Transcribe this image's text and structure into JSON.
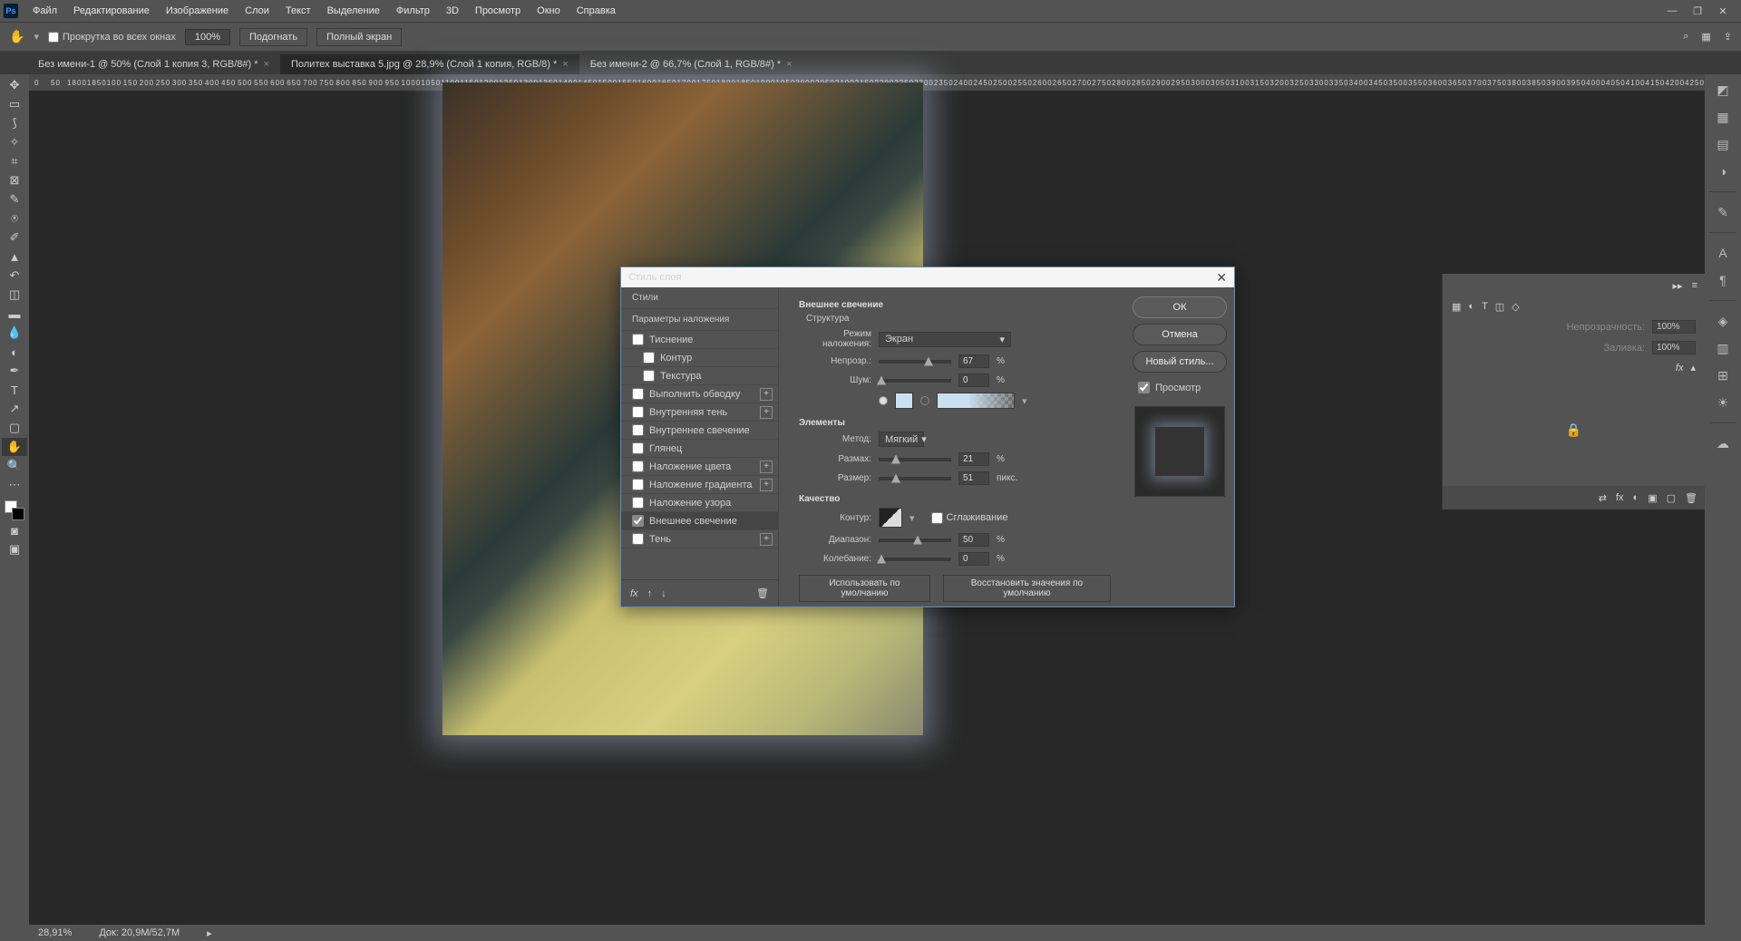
{
  "menubar": {
    "items": [
      "Файл",
      "Редактирование",
      "Изображение",
      "Слои",
      "Текст",
      "Выделение",
      "Фильтр",
      "3D",
      "Просмотр",
      "Окно",
      "Справка"
    ]
  },
  "optbar": {
    "scroll_all": "Прокрутка во всех окнах",
    "zoom": "100%",
    "fit": "Подогнать",
    "fullscreen": "Полный экран"
  },
  "tabs": [
    {
      "label": "Без имени-1 @ 50% (Слой 1 копия 3, RGB/8#) *",
      "active": false
    },
    {
      "label": "Политех выставка 5.jpg @ 28,9% (Слой 1 копия, RGB/8) *",
      "active": true
    },
    {
      "label": "Без имени-2 @ 66,7% (Слой 1, RGB/8#) *",
      "active": false
    }
  ],
  "ruler_h": [
    "0",
    "50",
    "1800",
    "1850",
    "100",
    "150",
    "200",
    "250",
    "300",
    "350",
    "400",
    "450",
    "500",
    "550",
    "600",
    "650",
    "700",
    "750",
    "800",
    "850",
    "900",
    "950",
    "1000",
    "1050",
    "1100",
    "1150",
    "1200",
    "1250",
    "1300",
    "1350",
    "1400",
    "1450",
    "1500",
    "1550",
    "1600",
    "1650",
    "1700",
    "1750",
    "1800",
    "1850",
    "1900",
    "1950",
    "2000",
    "2050",
    "2100",
    "2150",
    "2200",
    "2250",
    "2300",
    "2350",
    "2400",
    "2450",
    "2500",
    "2550",
    "2600",
    "2650",
    "2700",
    "2750",
    "2800",
    "2850",
    "2900",
    "2950",
    "3000",
    "3050",
    "3100",
    "3150",
    "3200",
    "3250",
    "3300",
    "3350",
    "3400",
    "3450",
    "3500",
    "3550",
    "3600",
    "3650",
    "3700",
    "3750",
    "3800",
    "3850",
    "3900",
    "3950",
    "4000",
    "4050",
    "4100",
    "4150",
    "4200",
    "4250"
  ],
  "props": {
    "opacity_label": "Непрозрачность:",
    "opacity": "100%",
    "fill_label": "Заливка:",
    "fill": "100%",
    "fx": "fx"
  },
  "status": {
    "zoom": "28,91%",
    "doc": "Док: 20,9М/52,7М"
  },
  "dialog": {
    "title": "Стиль слоя",
    "col1": {
      "styles_head": "Стили",
      "blend_head": "Параметры наложения",
      "rows": [
        {
          "label": "Тиснение",
          "sub": false,
          "plus": false,
          "checked": false
        },
        {
          "label": "Контур",
          "sub": true,
          "plus": false,
          "checked": false
        },
        {
          "label": "Текстура",
          "sub": true,
          "plus": false,
          "checked": false
        },
        {
          "label": "Выполнить обводку",
          "sub": false,
          "plus": true,
          "checked": false
        },
        {
          "label": "Внутренняя тень",
          "sub": false,
          "plus": true,
          "checked": false
        },
        {
          "label": "Внутреннее свечение",
          "sub": false,
          "plus": false,
          "checked": false
        },
        {
          "label": "Глянец",
          "sub": false,
          "plus": false,
          "checked": false
        },
        {
          "label": "Наложение цвета",
          "sub": false,
          "plus": true,
          "checked": false
        },
        {
          "label": "Наложение градиента",
          "sub": false,
          "plus": true,
          "checked": false
        },
        {
          "label": "Наложение узора",
          "sub": false,
          "plus": false,
          "checked": false
        },
        {
          "label": "Внешнее свечение",
          "sub": false,
          "plus": false,
          "checked": true,
          "selected": true
        },
        {
          "label": "Тень",
          "sub": false,
          "plus": true,
          "checked": false
        }
      ]
    },
    "col2": {
      "outer_glow": "Внешнее свечение",
      "structure": "Структура",
      "blend_mode_label": "Режим наложения:",
      "blend_mode": "Экран",
      "opacity_label": "Непрозр.:",
      "opacity": "67",
      "opacity_unit": "%",
      "noise_label": "Шум:",
      "noise": "0",
      "noise_unit": "%",
      "elements": "Элементы",
      "method_label": "Метод:",
      "method": "Мягкий",
      "spread_label": "Размах:",
      "spread": "21",
      "spread_unit": "%",
      "size_label": "Размер:",
      "size": "51",
      "size_unit": "пикс.",
      "quality": "Качество",
      "contour_label": "Контур:",
      "aa": "Сглаживание",
      "range_label": "Диапазон:",
      "range": "50",
      "range_unit": "%",
      "jitter_label": "Колебание:",
      "jitter": "0",
      "jitter_unit": "%",
      "use_default": "Использовать по умолчанию",
      "reset_default": "Восстановить значения по умолчанию"
    },
    "col3": {
      "ok": "ОК",
      "cancel": "Отмена",
      "new_style": "Новый стиль...",
      "preview": "Просмотр"
    }
  }
}
